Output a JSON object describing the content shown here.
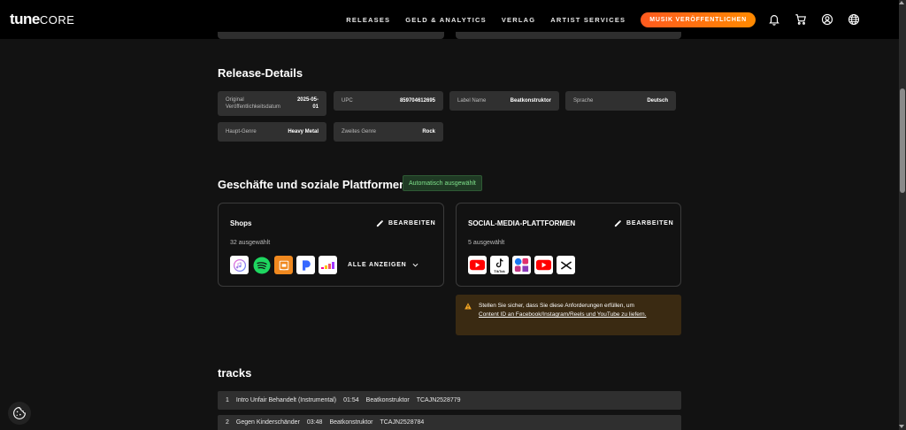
{
  "nav": {
    "logo_tune": "tune",
    "logo_core": "CORE",
    "links": [
      "RELEASES",
      "GELD & ANALYTICS",
      "VERLAG",
      "ARTIST SERVICES"
    ],
    "cta": "MUSIK VERÖFFENTLICHEN",
    "icons": [
      "bell-icon",
      "cart-icon",
      "user-icon",
      "globe-icon"
    ]
  },
  "release_details": {
    "title": "Release-Details",
    "fields": [
      {
        "label": "Original Veröffentlichkeitsdatum",
        "value": "2025-05-01"
      },
      {
        "label": "UPC",
        "value": "859704612695"
      },
      {
        "label": "Label Name",
        "value": "Beatkonstruktor"
      },
      {
        "label": "Sprache",
        "value": "Deutsch"
      },
      {
        "label": "Haupt-Genre",
        "value": "Heavy Metal"
      },
      {
        "label": "Zweites Genre",
        "value": "Rock"
      }
    ]
  },
  "stores": {
    "title": "Geschäfte und soziale Plattformen",
    "badge": "Automatisch ausgewählt",
    "shops": {
      "title": "Shops",
      "edit": "BEARBEITEN",
      "count": "32 ausgewählt",
      "show_all": "ALLE ANZEIGEN",
      "icons": [
        "itunes-icon",
        "spotify-icon",
        "amazon-music-icon",
        "pandora-icon",
        "deezer-icon"
      ]
    },
    "social": {
      "title": "SOCIAL-MEDIA-PLATTFORMEN",
      "edit": "BEARBEITEN",
      "count": "5 ausgewählt",
      "tiktok_label": "TikTok",
      "icons": [
        "youtube-icon",
        "tiktok-icon",
        "meta-icon",
        "youtube-content-id-icon",
        "capcut-icon"
      ]
    },
    "warning": {
      "text_1": "Stellen Sie sicher, dass Sie diese Anforderungen erfüllen, um",
      "link": "Content ID an Facebook/Instagram/Reels und YouTube zu liefern."
    }
  },
  "tracks": {
    "title": "tracks",
    "items": [
      {
        "num": "1",
        "name": "Intro Unfair Behandelt (Instrumental)",
        "duration": "01:54",
        "artist": "Beatkonstruktor",
        "isrc": "TCAJN2528779"
      },
      {
        "num": "2",
        "name": "Gegen Kinderschänder",
        "duration": "03:48",
        "artist": "Beatkonstruktor",
        "isrc": "TCAJN2528784"
      }
    ]
  },
  "colors": {
    "accent": "#ff6a14",
    "badge_green": "#7ee08a",
    "warn_bg": "#3a2a12"
  }
}
